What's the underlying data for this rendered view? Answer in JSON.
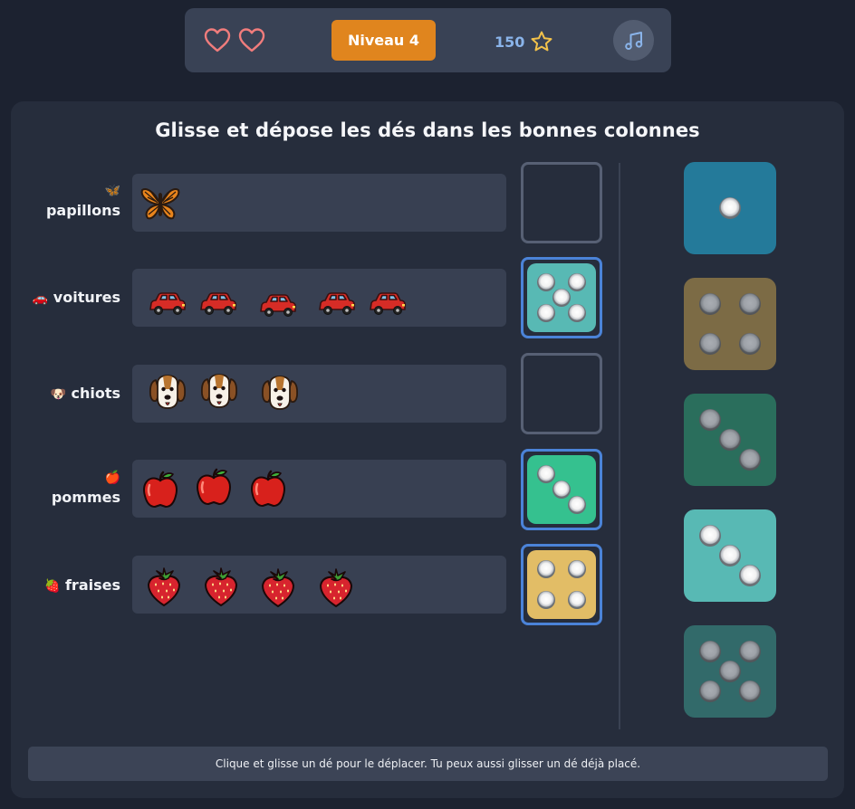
{
  "header": {
    "lives": 2,
    "level_label": "Niveau 4",
    "score": "150",
    "colors": {
      "level": "#e0851e",
      "heart": "#f07c7c",
      "star": "#f3c24a",
      "score": "#8ab4ea"
    },
    "icons": [
      "heart-icon",
      "star-icon",
      "music-note-icon"
    ]
  },
  "game": {
    "instruction": "Glisse et dépose les dés dans les bonnes colonnes",
    "hint": "Clique et glisse un dé pour le déplacer. Tu peux aussi glisser un dé déjà placé.",
    "rows": [
      {
        "label": "papillons",
        "emoji": "🦋",
        "count": 1,
        "slot": null
      },
      {
        "label": "voitures",
        "emoji": "🚗",
        "count": 5,
        "slot": {
          "value": 5,
          "color": "#58b9b4"
        }
      },
      {
        "label": "chiots",
        "emoji": "🐶",
        "count": 3,
        "slot": null
      },
      {
        "label": "pommes",
        "emoji": "🍎",
        "count": 3,
        "slot": {
          "value": 3,
          "color": "#35c18f"
        }
      },
      {
        "label": "fraises",
        "emoji": "🍓",
        "count": 4,
        "slot": {
          "value": 4,
          "color": "#e2bd66"
        }
      }
    ],
    "pool": [
      {
        "value": 1,
        "color": "#247a9a"
      },
      {
        "value": 4,
        "color": "#7c6b45"
      },
      {
        "value": 3,
        "color": "#2a6e5c"
      },
      {
        "value": 3,
        "color": "#58b9b4"
      },
      {
        "value": 5,
        "color": "#326a6a"
      }
    ]
  }
}
